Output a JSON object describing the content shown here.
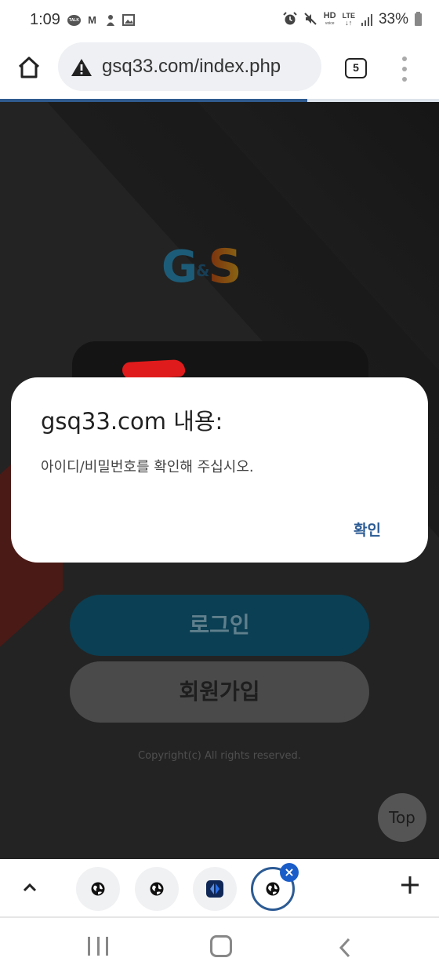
{
  "status_bar": {
    "time": "1:09",
    "left_icons": [
      "kakaotalk-icon",
      "gmail-icon",
      "notification-icon",
      "gallery-icon"
    ],
    "talk_label": "TALK",
    "gmail_glyph": "M",
    "hd_label": "HD",
    "voice_label": "voice",
    "lte_label": "LTE",
    "battery": "33%"
  },
  "browser": {
    "url": "gsq33.com/index.php",
    "tab_count": "5",
    "load_progress_percent": 70
  },
  "page": {
    "logo": {
      "g": "G",
      "amp": "&",
      "s": "S"
    },
    "login_button": "로그인",
    "signup_button": "회원가입",
    "copyright": "Copyright(c) All rights reserved.",
    "top_button": "Top"
  },
  "dialog": {
    "title": "gsq33.com 내용:",
    "message": "아이디/비밀번호를 확인해 주십시오.",
    "ok_button": "확인"
  },
  "tab_strip": {
    "tabs": [
      {
        "icon": "globe-icon",
        "active": false
      },
      {
        "icon": "globe-icon",
        "active": false
      },
      {
        "icon": "app-icon",
        "active": false
      },
      {
        "icon": "globe-icon",
        "active": true
      }
    ],
    "close_glyph": "×"
  },
  "colors": {
    "accent": "#2c5b94",
    "close_badge": "#1a5dc9",
    "page_bg": "#232323",
    "login_btn": "#0b3f53",
    "signup_btn": "#4a4a4a"
  }
}
